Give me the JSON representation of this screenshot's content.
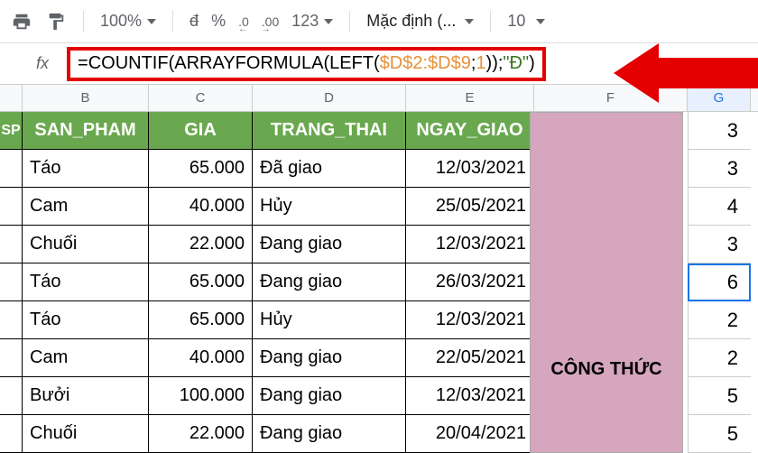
{
  "toolbar": {
    "zoom": "100%",
    "currency": "đ",
    "percent": "%",
    "dec_less": ".0",
    "dec_more": ".00",
    "num123": "123",
    "format_label": "Mặc định (...",
    "font_size": "10"
  },
  "formula_bar": {
    "fx": "fx",
    "part1": "=COUNTIF(ARRAYFORMULA(LEFT(",
    "ref": "$D$2:$D$9",
    "part2": ";",
    "arg1": "1",
    "part3": "));",
    "str": "\"Đ\"",
    "part4": ")"
  },
  "col_labels": {
    "A": "",
    "B": "B",
    "C": "C",
    "D": "D",
    "E": "E",
    "F": "F",
    "G": "G"
  },
  "headers": {
    "a": "SP",
    "b": "SAN_PHAM",
    "c": "GIA",
    "d": "TRANG_THAI",
    "e": "NGAY_GIAO"
  },
  "f_col_label": "CÔNG THỨC",
  "rows": [
    {
      "b": "Táo",
      "c": "65.000",
      "d": "Đã giao",
      "e": "12/03/2021",
      "g": "3"
    },
    {
      "b": "Cam",
      "c": "40.000",
      "d": "Hủy",
      "e": "25/05/2021",
      "g": "4"
    },
    {
      "b": "Chuối",
      "c": "22.000",
      "d": "Đang giao",
      "e": "12/03/2021",
      "g": "3"
    },
    {
      "b": "Táo",
      "c": "65.000",
      "d": "Đang giao",
      "e": "26/03/2021",
      "g": "6"
    },
    {
      "b": "Táo",
      "c": "65.000",
      "d": "Hủy",
      "e": "12/03/2021",
      "g": "2"
    },
    {
      "b": "Cam",
      "c": "40.000",
      "d": "Đang giao",
      "e": "22/05/2021",
      "g": "2"
    },
    {
      "b": "Bưởi",
      "c": "100.000",
      "d": "Đang giao",
      "e": "12/03/2021",
      "g": "5"
    },
    {
      "b": "Chuối",
      "c": "22.000",
      "d": "Đang giao",
      "e": "20/04/2021",
      "g": "5"
    }
  ],
  "g_header_value": "3",
  "selected_g_row_index": 3
}
